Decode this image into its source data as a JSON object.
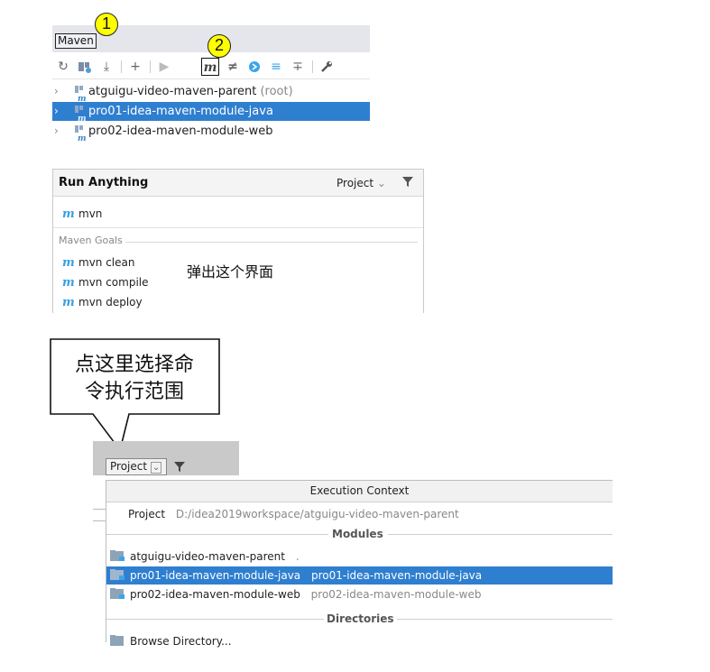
{
  "maven": {
    "tab_label": "Maven",
    "callout_1": "1",
    "callout_2": "2",
    "toolbar_icons": [
      "reload-icon",
      "reimport-icon",
      "download-icon",
      "add-icon",
      "run-icon",
      "execute-goal-icon",
      "toggle-offline-icon",
      "skip-tests-icon",
      "show-deps-icon",
      "collapse-icon",
      "settings-icon"
    ],
    "projects": [
      {
        "name": "atguigu-video-maven-parent",
        "suffix": "(root)"
      },
      {
        "name": "pro01-idea-maven-module-java",
        "suffix": ""
      },
      {
        "name": "pro02-idea-maven-module-web",
        "suffix": ""
      }
    ],
    "selected_index": 1,
    "selection_color": "#2f7fd0"
  },
  "run_anything": {
    "title": "Run Anything",
    "project_label": "Project",
    "input_value": "mvn",
    "goals_section": "Maven Goals",
    "goals": [
      "mvn clean",
      "mvn compile",
      "mvn deploy"
    ],
    "annotation": "弹出这个界面"
  },
  "callout": {
    "line1": "点这里选择命",
    "line2": "令执行范围"
  },
  "execution_context": {
    "button_label": "Project",
    "header": "Execution Context",
    "project_row_label": "Project",
    "project_row_path": "D:/idea2019workspace/atguigu-video-maven-parent",
    "modules_label": "Modules",
    "modules": [
      {
        "name": "atguigu-video-maven-parent",
        "path": "."
      },
      {
        "name": "pro01-idea-maven-module-java",
        "path": "pro01-idea-maven-module-java"
      },
      {
        "name": "pro02-idea-maven-module-web",
        "path": "pro02-idea-maven-module-web"
      }
    ],
    "selected_module_index": 1,
    "directories_label": "Directories",
    "browse_label": "Browse Directory..."
  }
}
